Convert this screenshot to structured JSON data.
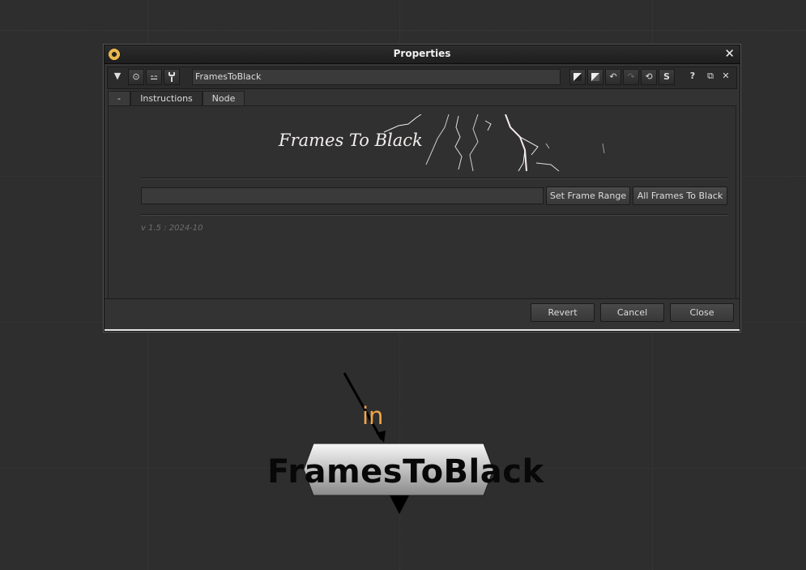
{
  "window": {
    "title": "Properties",
    "close_glyph": "✕",
    "logo_icon": "nuke-icon"
  },
  "toolbar": {
    "collapse_glyph": "▼",
    "node_name": "FramesToBlack",
    "buttons": [
      {
        "name": "center-node-icon",
        "glyph": "⊙"
      },
      {
        "name": "input-toggle-icon",
        "glyph": "⚍"
      },
      {
        "name": "settings-wrench-icon",
        "glyph": "🔧"
      }
    ],
    "right_buttons": [
      {
        "name": "knob-default-icon",
        "glyph": "◩"
      },
      {
        "name": "knob-value-icon",
        "glyph": "◩"
      },
      {
        "name": "undo-icon",
        "glyph": "↶"
      },
      {
        "name": "redo-icon",
        "glyph": "↷"
      },
      {
        "name": "revert-icon",
        "glyph": "⟲"
      },
      {
        "name": "script-icon",
        "glyph": "S"
      },
      {
        "name": "help-icon",
        "glyph": "?"
      },
      {
        "name": "float-icon",
        "glyph": "⧉"
      },
      {
        "name": "close-panel-icon",
        "glyph": "✕"
      }
    ]
  },
  "tabs": [
    {
      "label": "-"
    },
    {
      "label": "Instructions"
    },
    {
      "label": "Node"
    }
  ],
  "main": {
    "banner_text": "Frames To Black",
    "frame_range_value": "",
    "set_frame_range_label": "Set Frame Range",
    "all_frames_label": "All Frames To Black",
    "version": "v 1.5 : 2024-10"
  },
  "footer": {
    "revert_label": "Revert",
    "cancel_label": "Cancel",
    "close_label": "Close"
  },
  "node": {
    "input_label": "in",
    "title": "FramesToBlack",
    "input_label_color": "#f1a54b"
  },
  "colors": {
    "background": "#2e2e2e",
    "window": "#333333",
    "accent": "#e8b64a"
  }
}
